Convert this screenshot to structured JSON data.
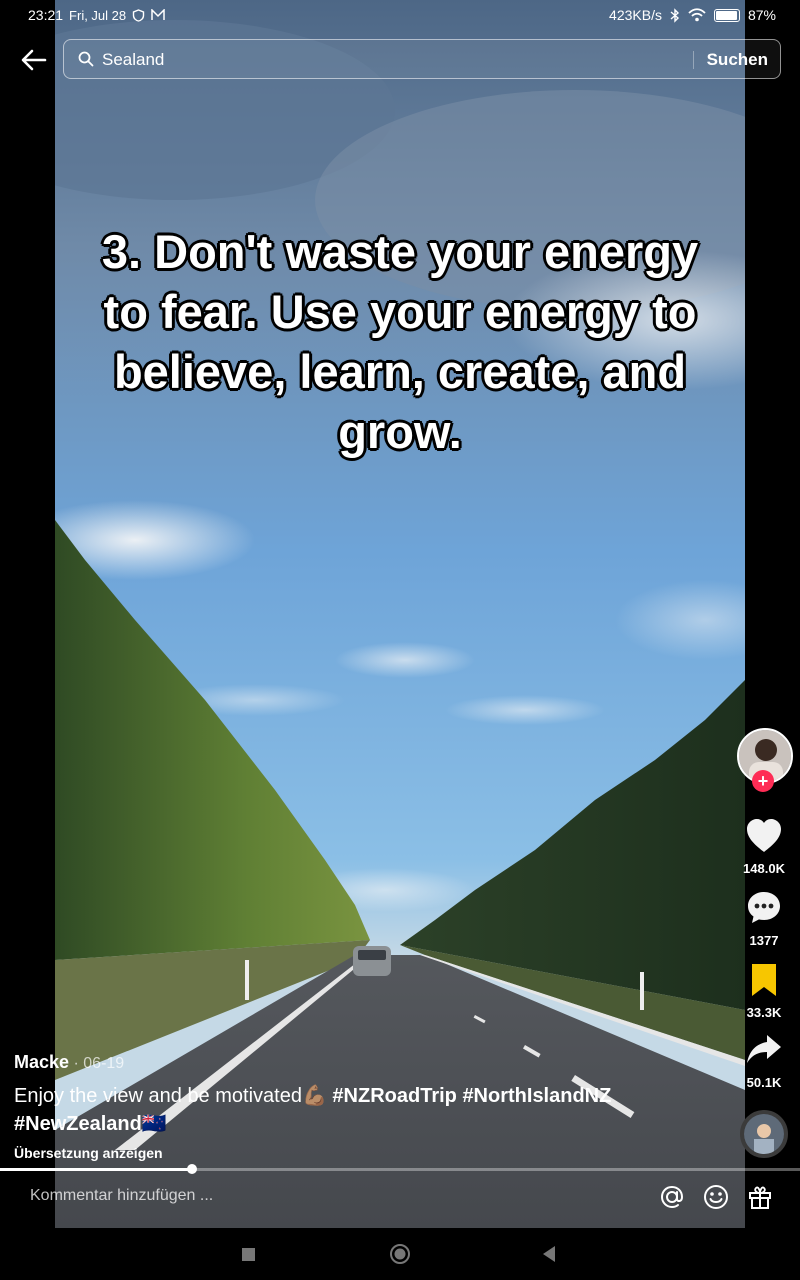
{
  "status_bar": {
    "time": "23:21",
    "date": "Fri, Jul 28",
    "net_speed": "423KB/s",
    "battery": "87%",
    "battery_level": 0.87
  },
  "search": {
    "query": "Sealand",
    "submit_label": "Suchen"
  },
  "video": {
    "overlay_text": "3. Don't waste your energy to fear. Use your energy to believe, learn, create, and grow."
  },
  "actions": {
    "like_count": "148.0K",
    "comment_count": "1377",
    "save_count": "33.3K",
    "share_count": "50.1K",
    "follow_symbol": "+"
  },
  "post": {
    "author": "Macke",
    "date": " · 06-19",
    "description": "Enjoy the view and be motivated💪🏽 ",
    "hashtags": [
      "#NZRoadTrip",
      "#NorthIslandNZ",
      "#NewZealand"
    ],
    "flag": "🇳🇿",
    "translate_label": "Übersetzung anzeigen",
    "progress": 0.24
  },
  "comment": {
    "placeholder": "Kommentar hinzufügen ..."
  },
  "colors": {
    "follow": "#fe2c55",
    "save": "#f7c600"
  }
}
